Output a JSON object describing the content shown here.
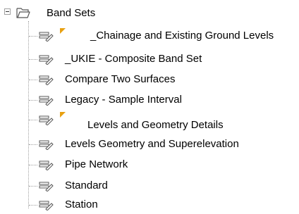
{
  "tree": {
    "root": {
      "label": "Band Sets",
      "icon": "folder-open-icon",
      "expanded": true
    },
    "items": [
      {
        "label": "_Chainage and Existing Ground Levels",
        "icon": "band-set-icon",
        "marker": "orange-flag"
      },
      {
        "label": "_UKIE - Composite Band Set",
        "icon": "band-set-icon"
      },
      {
        "label": "Compare Two Surfaces",
        "icon": "band-set-icon"
      },
      {
        "label": "Legacy - Sample Interval",
        "icon": "band-set-icon"
      },
      {
        "label": "Levels and Geometry Details",
        "icon": "band-set-icon",
        "marker": "orange-flag"
      },
      {
        "label": "Levels Geometry and Superelevation",
        "icon": "band-set-icon"
      },
      {
        "label": "Pipe Network",
        "icon": "band-set-icon"
      },
      {
        "label": "Standard",
        "icon": "band-set-icon"
      },
      {
        "label": "Station",
        "icon": "band-set-icon"
      }
    ]
  },
  "colors": {
    "marker": "#e8a010",
    "icon_stroke": "#555555",
    "guide": "#a0a0a0"
  }
}
